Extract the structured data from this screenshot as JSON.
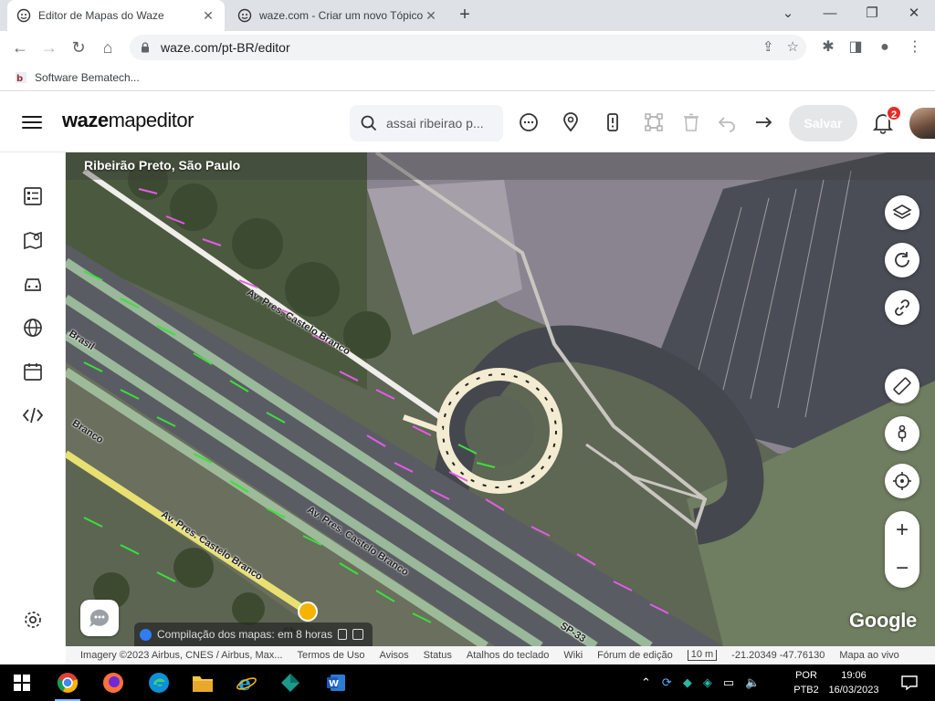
{
  "browser": {
    "tabs": [
      {
        "title": "Editor de Mapas do Waze",
        "active": true
      },
      {
        "title": "waze.com - Criar um novo Tópico",
        "active": false
      }
    ],
    "url": "waze.com/pt-BR/editor",
    "bookmark": "Software Bematech..."
  },
  "header": {
    "brand_bold": "waze",
    "brand_light": "mapeditor",
    "search_placeholder": "assai ribeirao p...",
    "save_label": "Salvar",
    "notifications": "2"
  },
  "map": {
    "location": "Ribeirão Preto, São Paulo",
    "street1": "Av. Pres. Castelo Branco",
    "street2": "Av. Pres. Castelo Branco",
    "street3": "Av. Pres. Castelo Branco",
    "street4": "Branco",
    "street5": "Brasil",
    "street6": "SP-33",
    "street7": "Sh",
    "google": "Google",
    "compile_text": "Compilação dos mapas: em 8 horas"
  },
  "footer": {
    "imagery": "Imagery ©2023 Airbus, CNES / Airbus, Max...",
    "links": [
      "Termos de Uso",
      "Avisos",
      "Status",
      "Atalhos do teclado",
      "Wiki",
      "Fórum de edição"
    ],
    "scale": "10 m",
    "coords": "-21.20349 -47.76130",
    "map_live": "Mapa ao vivo"
  },
  "taskbar": {
    "lang1": "POR",
    "lang2": "PTB2",
    "time": "19:06",
    "date": "16/03/2023"
  }
}
